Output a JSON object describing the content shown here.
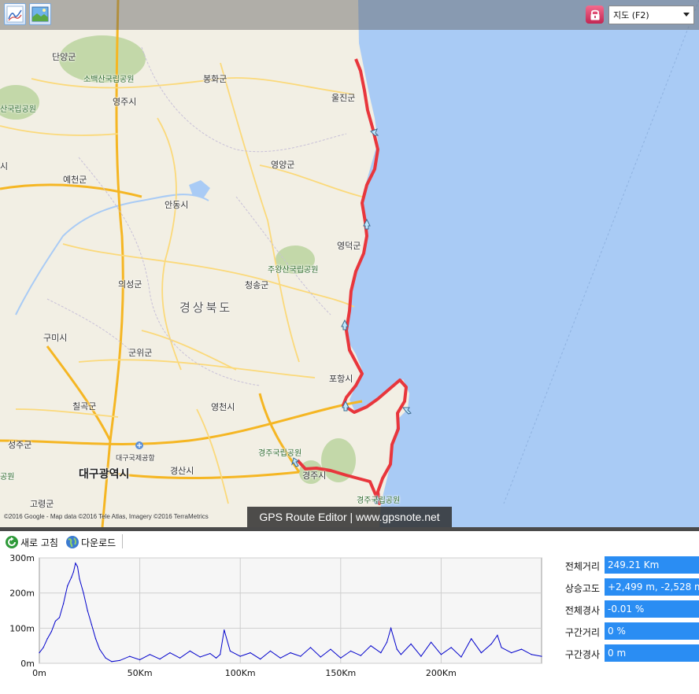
{
  "toolbar_top": {
    "map_type_selected": "지도 (F2)",
    "chart_icon": "chart-line-icon",
    "image_icon": "landscape-image-icon",
    "lock_icon": "lock-icon"
  },
  "map": {
    "places": [
      {
        "name": "단양군",
        "kind": "county"
      },
      {
        "name": "소백산국립공원",
        "kind": "park"
      },
      {
        "name": "봉화군",
        "kind": "county"
      },
      {
        "name": "산국립공원",
        "kind": "park"
      },
      {
        "name": "영주시",
        "kind": "city"
      },
      {
        "name": "울진군",
        "kind": "county"
      },
      {
        "name": "시",
        "kind": "city"
      },
      {
        "name": "예천군",
        "kind": "county"
      },
      {
        "name": "영양군",
        "kind": "county"
      },
      {
        "name": "안동시",
        "kind": "city"
      },
      {
        "name": "영덕군",
        "kind": "county"
      },
      {
        "name": "주왕산국립공원",
        "kind": "park"
      },
      {
        "name": "청송군",
        "kind": "county"
      },
      {
        "name": "의성군",
        "kind": "county"
      },
      {
        "name": "경상북도",
        "kind": "region"
      },
      {
        "name": "구미시",
        "kind": "city"
      },
      {
        "name": "군위군",
        "kind": "county"
      },
      {
        "name": "포항시",
        "kind": "city"
      },
      {
        "name": "칠곡군",
        "kind": "county"
      },
      {
        "name": "영천시",
        "kind": "city"
      },
      {
        "name": "성주군",
        "kind": "county"
      },
      {
        "name": "경주국립공원",
        "kind": "park"
      },
      {
        "name": "대구국제공항",
        "kind": "airport"
      },
      {
        "name": "경산시",
        "kind": "city"
      },
      {
        "name": "경주시",
        "kind": "city"
      },
      {
        "name": "대구광역시",
        "kind": "metro"
      },
      {
        "name": "공원",
        "kind": "park"
      },
      {
        "name": "고령군",
        "kind": "county"
      },
      {
        "name": "경주국립공원",
        "kind": "park"
      }
    ],
    "attribution": "©2016 Google - Map data ©2016 Tele Atlas, Imagery ©2016 TerraMetrics",
    "brand": "GPS Route Editor | www.gpsnote.net",
    "colors": {
      "sea": "#a9cbf5",
      "land": "#f2efe4",
      "route": "#e8363c",
      "highway": "#f5b623",
      "road": "#fbd97a",
      "park": "#b7d29a"
    }
  },
  "bottom_toolbar": {
    "refresh_label": "새로 고침",
    "download_label": "다운로드"
  },
  "chart_data": {
    "type": "line",
    "x_unit": "Km",
    "y_unit": "m",
    "xlim": [
      0,
      250
    ],
    "ylim": [
      0,
      300
    ],
    "x_ticks": [
      0,
      50,
      100,
      150,
      200
    ],
    "x_tick_labels": [
      "0m",
      "50Km",
      "100Km",
      "150Km",
      "200Km"
    ],
    "y_ticks": [
      0,
      100,
      200,
      300
    ],
    "y_tick_labels": [
      "0m",
      "100m",
      "200m",
      "300m"
    ],
    "grid": true,
    "series": [
      {
        "color": "#0000cc",
        "x": [
          0,
          2,
          4,
          6,
          8,
          10,
          12,
          14,
          16,
          17,
          18,
          19,
          20,
          22,
          24,
          26,
          28,
          30,
          33,
          36,
          40,
          45,
          50,
          55,
          60,
          65,
          70,
          75,
          80,
          85,
          88,
          90,
          92,
          95,
          100,
          105,
          110,
          115,
          120,
          125,
          130,
          135,
          140,
          145,
          150,
          155,
          160,
          165,
          170,
          173,
          175,
          178,
          180,
          185,
          190,
          195,
          200,
          205,
          210,
          215,
          220,
          225,
          228,
          230,
          235,
          240,
          245,
          250
        ],
        "y": [
          30,
          45,
          70,
          90,
          120,
          130,
          170,
          220,
          245,
          260,
          285,
          275,
          240,
          200,
          150,
          110,
          70,
          40,
          15,
          5,
          8,
          20,
          10,
          25,
          12,
          30,
          15,
          35,
          18,
          28,
          15,
          25,
          95,
          35,
          20,
          30,
          12,
          35,
          15,
          30,
          20,
          45,
          18,
          40,
          15,
          35,
          22,
          50,
          30,
          60,
          100,
          40,
          25,
          55,
          20,
          60,
          25,
          45,
          18,
          70,
          30,
          55,
          80,
          45,
          30,
          40,
          25,
          20
        ]
      }
    ]
  },
  "stats": [
    {
      "label": "전체거리",
      "value": "249.21 Km"
    },
    {
      "label": "상승고도",
      "value": "+2,499 m, -2,528 m"
    },
    {
      "label": "전체경사",
      "value": "-0.01 %"
    },
    {
      "label": "구간거리",
      "value": "0 %"
    },
    {
      "label": "구간경사",
      "value": "0 m"
    }
  ]
}
